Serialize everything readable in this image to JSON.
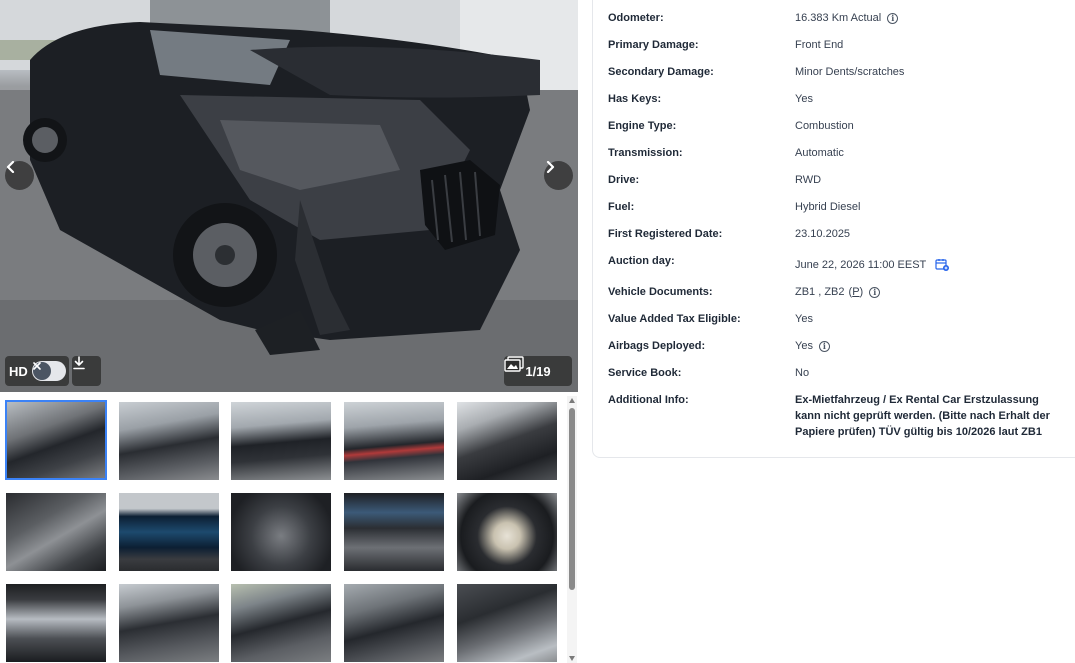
{
  "gallery": {
    "hd_label": "HD",
    "photo_counter": "1/19",
    "icons": {
      "prev": "chevron-left-icon",
      "next": "chevron-right-icon",
      "hd_off": "close-icon",
      "download": "download-icon",
      "photos": "image-gallery-icon"
    },
    "thumbnail_count": 15,
    "active_thumbnail": 1
  },
  "details": {
    "odometer": {
      "label": "Odometer:",
      "value": "16.383 Km Actual"
    },
    "primary_damage": {
      "label": "Primary Damage:",
      "value": "Front End"
    },
    "secondary_damage": {
      "label": "Secondary Damage:",
      "value": "Minor Dents/scratches"
    },
    "has_keys": {
      "label": "Has Keys:",
      "value": "Yes"
    },
    "engine_type": {
      "label": "Engine Type:",
      "value": "Combustion"
    },
    "transmission": {
      "label": "Transmission:",
      "value": "Automatic"
    },
    "drive": {
      "label": "Drive:",
      "value": "RWD"
    },
    "fuel": {
      "label": "Fuel:",
      "value": "Hybrid Diesel"
    },
    "first_registered": {
      "label": "First Registered Date:",
      "value": "23.10.2025"
    },
    "auction_day": {
      "label": "Auction day:",
      "value": "June 22, 2026 11:00 EEST"
    },
    "vehicle_documents": {
      "label": "Vehicle Documents:",
      "value": "ZB1 , ZB2",
      "link": "P"
    },
    "vat_eligible": {
      "label": "Value Added Tax Eligible:",
      "value": "Yes"
    },
    "airbags_deployed": {
      "label": "Airbags Deployed:",
      "value": "Yes"
    },
    "service_book": {
      "label": "Service Book:",
      "value": "No"
    },
    "additional_info": {
      "label": "Additional Info:",
      "value": "Ex-Mietfahrzeug / Ex Rental Car Erstzulassung kann nicht geprüft werden. (Bitte nach Erhalt der Papiere prüfen) TÜV gültig bis 10/2026 laut ZB1"
    }
  },
  "colors": {
    "accent": "#3b82f6",
    "calendar_icon": "#2563eb"
  }
}
